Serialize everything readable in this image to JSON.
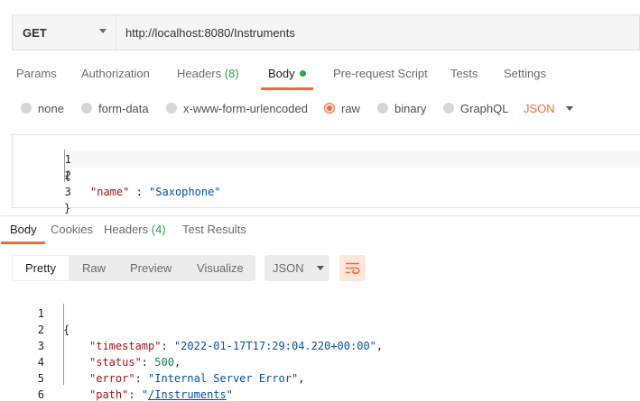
{
  "request": {
    "method": "GET",
    "url": "http://localhost:8080/Instruments"
  },
  "request_tabs": [
    {
      "label": "Params"
    },
    {
      "label": "Authorization"
    },
    {
      "label": "Headers",
      "count": "(8)"
    },
    {
      "label": "Body",
      "active": true
    },
    {
      "label": "Pre-request Script"
    },
    {
      "label": "Tests"
    },
    {
      "label": "Settings"
    }
  ],
  "body_types": [
    {
      "label": "none"
    },
    {
      "label": "form-data"
    },
    {
      "label": "x-www-form-urlencoded"
    },
    {
      "label": "raw",
      "selected": true
    },
    {
      "label": "binary"
    },
    {
      "label": "GraphQL"
    }
  ],
  "body_language": "JSON",
  "request_body": {
    "line_numbers": [
      "1",
      "2",
      "3"
    ],
    "open_brace": "{",
    "key": "\"name\"",
    "separator": " : ",
    "value": "\"Saxophone\"",
    "close_brace": "}"
  },
  "response_tabs": [
    {
      "label": "Body",
      "active": true
    },
    {
      "label": "Cookies"
    },
    {
      "label": "Headers",
      "count": "(4)"
    },
    {
      "label": "Test Results"
    }
  ],
  "view_modes": [
    {
      "label": "Pretty",
      "active": true
    },
    {
      "label": "Raw"
    },
    {
      "label": "Preview"
    },
    {
      "label": "Visualize"
    }
  ],
  "response_format": "JSON",
  "response_body": {
    "line_numbers": [
      "1",
      "2",
      "3",
      "4",
      "5",
      "6"
    ],
    "open_brace": "{",
    "close_brace": "}",
    "timestamp_key": "\"timestamp\"",
    "timestamp_value": "\"2022-01-17T17:29:04.220+00:00\"",
    "status_key": "\"status\"",
    "status_value": "500",
    "error_key": "\"error\"",
    "error_value": "\"Internal Server Error\"",
    "path_key": "\"path\"",
    "path_quote": "\"",
    "path_value": "/Instruments"
  },
  "colors": {
    "accent": "#f26b3a",
    "success": "#28a745",
    "string": "#0451a5",
    "key": "#a31515",
    "number": "#098658"
  }
}
